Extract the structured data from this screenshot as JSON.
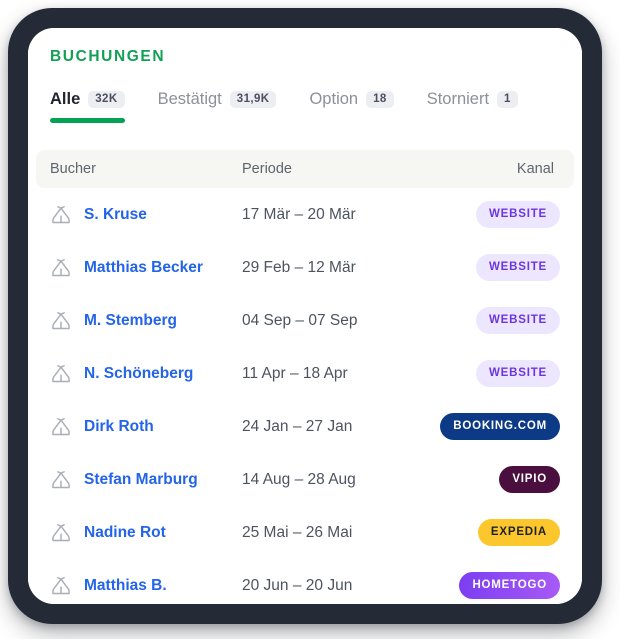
{
  "header": {
    "title": "BUCHUNGEN"
  },
  "tabs": [
    {
      "label": "Alle",
      "count": "32K",
      "active": true
    },
    {
      "label": "Bestätigt",
      "count": "31,9K",
      "active": false
    },
    {
      "label": "Option",
      "count": "18",
      "active": false
    },
    {
      "label": "Storniert",
      "count": "1",
      "active": false
    }
  ],
  "table": {
    "columns": [
      "Bucher",
      "Periode",
      "Kanal"
    ],
    "rows": [
      {
        "icon": "cabin-icon",
        "booker": "S. Kruse",
        "period": "17 Mär – 20 Mär",
        "channel": "WEBSITE",
        "channel_style": "website"
      },
      {
        "icon": "cabin-icon",
        "booker": "Matthias Becker",
        "period": "29 Feb – 12 Mär",
        "channel": "WEBSITE",
        "channel_style": "website"
      },
      {
        "icon": "cabin-icon",
        "booker": "M. Stemberg",
        "period": "04 Sep – 07 Sep",
        "channel": "WEBSITE",
        "channel_style": "website"
      },
      {
        "icon": "cabin-icon",
        "booker": "N. Schöneberg",
        "period": "11 Apr – 18 Apr",
        "channel": "WEBSITE",
        "channel_style": "website"
      },
      {
        "icon": "cabin-icon",
        "booker": "Dirk Roth",
        "period": "24 Jan – 27 Jan",
        "channel": "BOOKING.COM",
        "channel_style": "booking"
      },
      {
        "icon": "cabin-icon",
        "booker": "Stefan Marburg",
        "period": "14 Aug – 28 Aug",
        "channel": "VIPIO",
        "channel_style": "vipio"
      },
      {
        "icon": "cabin-icon",
        "booker": "Nadine Rot",
        "period": "25 Mai – 26 Mai",
        "channel": "EXPEDIA",
        "channel_style": "expedia"
      },
      {
        "icon": "cabin-icon",
        "booker": "Matthias B.",
        "period": "20 Jun – 20 Jun",
        "channel": "HOMETOGO",
        "channel_style": "hometogo"
      }
    ]
  },
  "colors": {
    "brand_green": "#05a155",
    "link_blue": "#2364e8",
    "bezel": "#242a36",
    "header_band": "#f6f7f2",
    "badge_website_bg": "#ece7fe",
    "badge_website_fg": "#6d35e0",
    "badge_booking_bg": "#0d3a86",
    "badge_vipio_bg": "#4a0f3e",
    "badge_expedia_bg": "#fcc72c",
    "badge_hometogo_bg": "#8f4af4"
  }
}
